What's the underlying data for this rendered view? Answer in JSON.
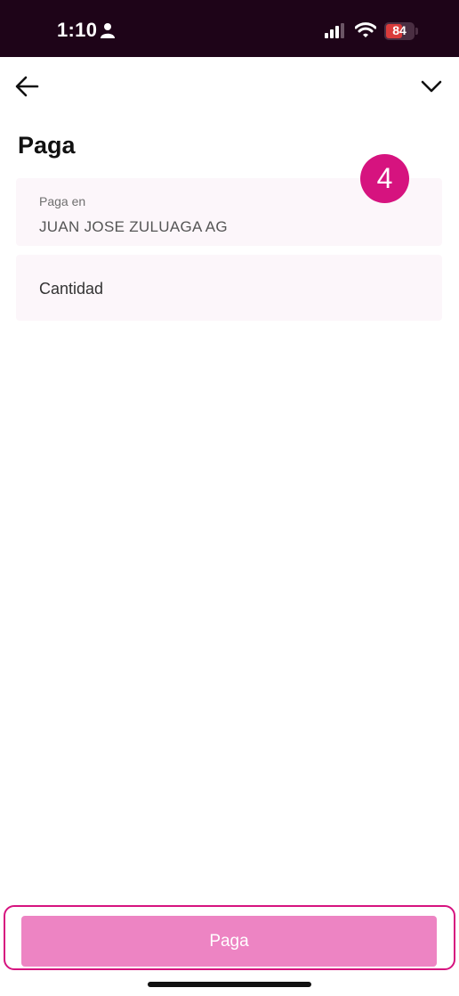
{
  "status_bar": {
    "time": "1:10",
    "battery": "84"
  },
  "header": {
    "title": "Paga"
  },
  "step_badge": "4",
  "form": {
    "merchant_label": "Paga en",
    "merchant_value": "JUAN JOSE ZULUAGA AG",
    "amount_placeholder": "Cantidad"
  },
  "footer": {
    "pay_label": "Paga"
  },
  "colors": {
    "status_bar_bg": "#1e0418",
    "accent": "#d6137f",
    "button_disabled": "#ed84c3",
    "field_bg": "#fcf6fa"
  },
  "icons": [
    "person-icon",
    "signal-icon",
    "wifi-icon",
    "battery-icon",
    "back-arrow-icon",
    "chevron-down-icon"
  ]
}
